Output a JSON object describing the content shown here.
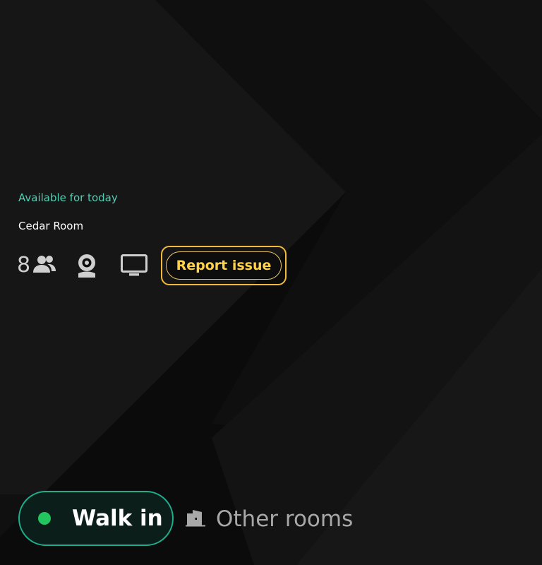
{
  "room": {
    "status": "Available for today",
    "name": "Cedar Room",
    "capacity": "8"
  },
  "features": {
    "capacity_icon": "people-icon",
    "camera_icon": "webcam-icon",
    "display_icon": "monitor-icon"
  },
  "actions": {
    "report_issue": "Report issue",
    "walk_in": "Walk in",
    "other_rooms": "Other rooms"
  },
  "colors": {
    "accent_status": "#4fd1b5",
    "report_highlight": "#f2b93a",
    "report_text": "#ffd24a",
    "walkin_border": "#1fae8c",
    "walkin_dot": "#22c55e"
  }
}
